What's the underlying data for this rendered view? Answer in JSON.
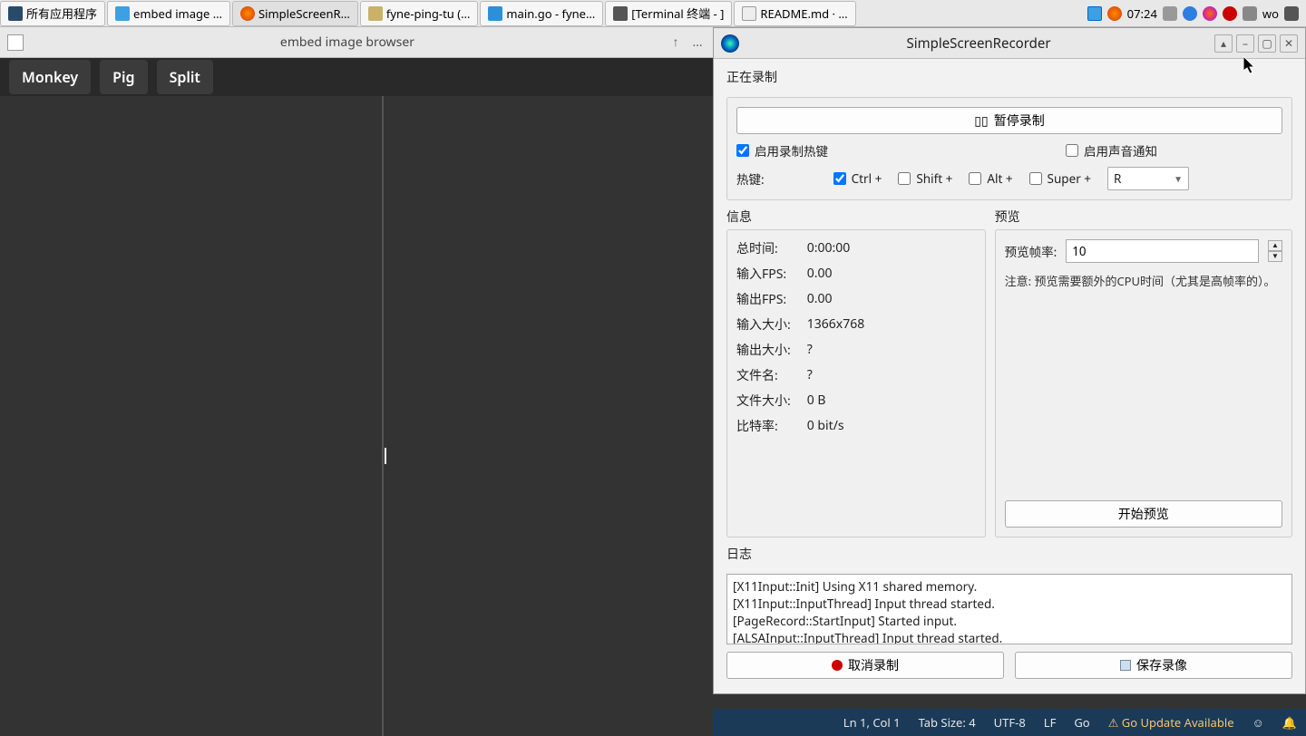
{
  "taskbar": {
    "menu": "所有应用程序",
    "items": [
      {
        "label": "embed image …",
        "icon": "blue"
      },
      {
        "label": "SimpleScreenR…",
        "icon": "ssr",
        "active": true
      },
      {
        "label": "fyne-ping-tu (…",
        "icon": "folder"
      },
      {
        "label": "main.go - fyne…",
        "icon": "vs"
      },
      {
        "label": "[Terminal 终端 - ]",
        "icon": "term"
      },
      {
        "label": "README.md · …",
        "icon": "chrome"
      }
    ],
    "clock": "07:24",
    "lang": "wo"
  },
  "left_window": {
    "title": "embed image browser",
    "buttons": [
      "Monkey",
      "Pig",
      "Split"
    ]
  },
  "ssr": {
    "title": "SimpleScreenRecorder",
    "section_record": "正在录制",
    "pause_btn": "暂停录制",
    "chk_hotkey": "启用录制热键",
    "chk_sound": "启用声音通知",
    "hotkey_label": "热键:",
    "mods": {
      "ctrl": "Ctrl +",
      "shift": "Shift +",
      "alt": "Alt +",
      "super": "Super +"
    },
    "hotkey_key": "R",
    "section_info": "信息",
    "section_preview": "预览",
    "info": [
      {
        "k": "总时间:",
        "v": "0:00:00"
      },
      {
        "k": "输入FPS:",
        "v": "0.00"
      },
      {
        "k": "输出FPS:",
        "v": "0.00"
      },
      {
        "k": "输入大小:",
        "v": "1366x768"
      },
      {
        "k": "输出大小:",
        "v": "?"
      },
      {
        "k": "文件名:",
        "v": "?"
      },
      {
        "k": "文件大小:",
        "v": "0 B"
      },
      {
        "k": "比特率:",
        "v": "0 bit/s"
      }
    ],
    "preview_rate_label": "预览帧率:",
    "preview_rate": "10",
    "preview_note": "注意: 预览需要额外的CPU时间（尤其是高帧率的）。",
    "start_preview": "开始预览",
    "section_log": "日志",
    "log": [
      "[X11Input::Init] Using X11 shared memory.",
      "[X11Input::InputThread] Input thread started.",
      "[PageRecord::StartInput] Started input.",
      "[ALSAInput::InputThread] Input thread started."
    ],
    "cancel_btn": "取消录制",
    "save_btn": "保存录像"
  },
  "statusbar": {
    "pos": "Ln 1, Col 1",
    "tab": "Tab Size: 4",
    "enc": "UTF-8",
    "eol": "LF",
    "lang": "Go",
    "update": "Go Update Available"
  }
}
